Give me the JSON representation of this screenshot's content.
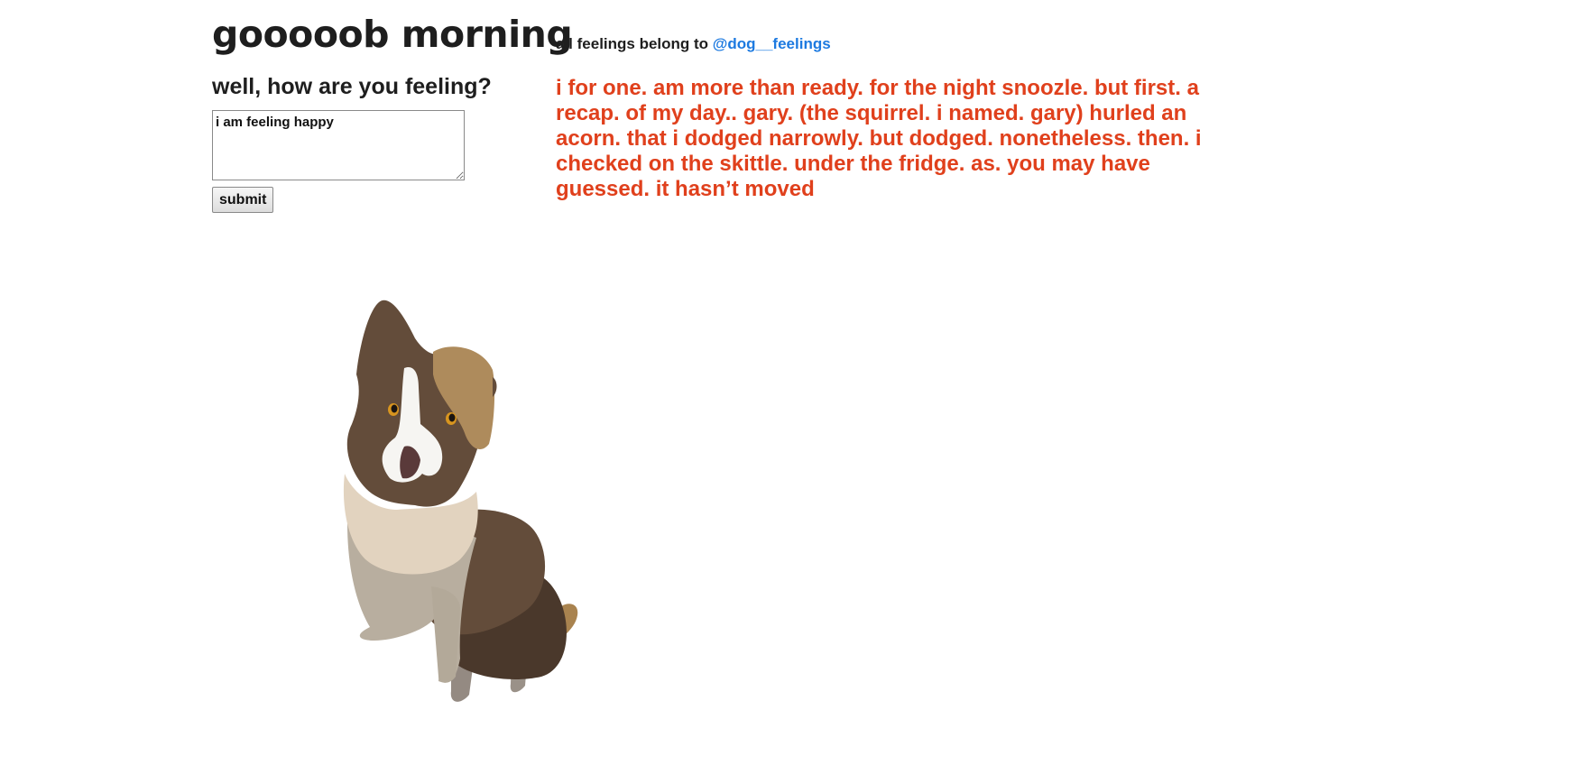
{
  "header": {
    "title": "gooooob morning",
    "credit_prefix": "all feelings belong to ",
    "credit_link": "@dog__feelings"
  },
  "form": {
    "prompt": "well, how are you feeling?",
    "input_value": "i am feeling happy",
    "submit_label": "submit"
  },
  "response": {
    "text": "i for one. am more than ready. for the night snoozle. but first. a recap. of my day.. gary. (the squirrel. i named. gary) hurled an acorn. that i dodged narrowly. but dodged. nonetheless. then. i checked on the skittle. under the fridge. as. you may have guessed. it hasn’t moved"
  },
  "colors": {
    "response_text": "#e0401c",
    "link": "#1d7ae0",
    "heading": "#1e1e1e"
  },
  "illustration": {
    "icon": "dog-illustration"
  }
}
